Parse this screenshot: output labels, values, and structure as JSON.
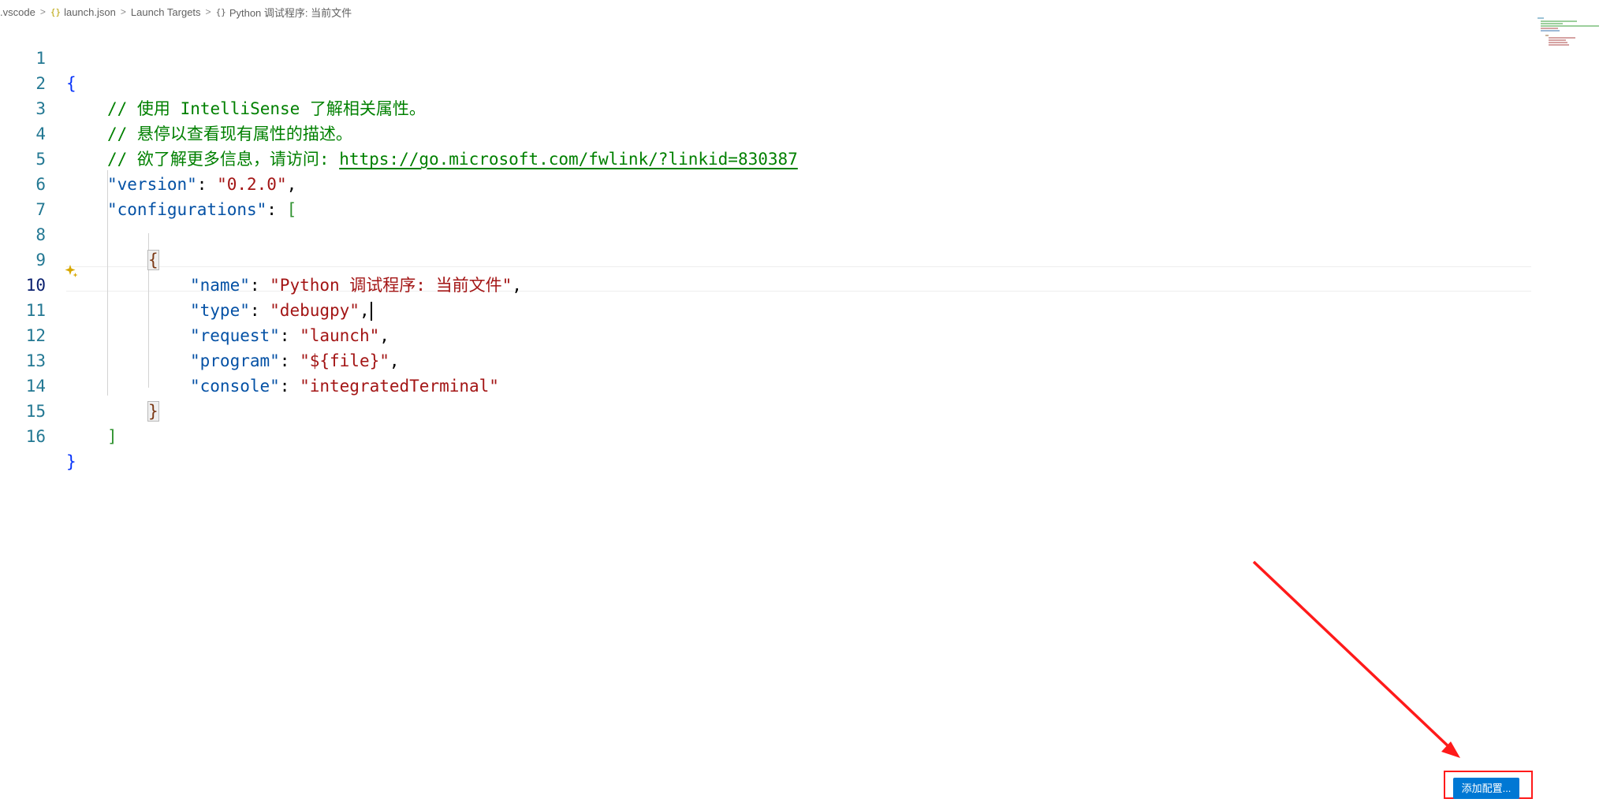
{
  "breadcrumb": {
    "folder": ".vscode",
    "file_icon": "{}",
    "file": "launch.json",
    "section": "Launch Targets",
    "object_icon": "{}",
    "item": "Python 调试程序: 当前文件",
    "separator": ">"
  },
  "editor": {
    "active_line": 10,
    "lines": [
      {
        "num": "1"
      },
      {
        "num": "2",
        "comment": "// 使用 IntelliSense 了解相关属性。"
      },
      {
        "num": "3",
        "comment": "// 悬停以查看现有属性的描述。"
      },
      {
        "num": "4",
        "comment": "// 欲了解更多信息，请访问: ",
        "link": "https://go.microsoft.com/fwlink/?linkid=830387"
      },
      {
        "num": "5",
        "key": "\"version\"",
        "value": "\"0.2.0\""
      },
      {
        "num": "6",
        "key": "\"configurations\""
      },
      {
        "num": "7"
      },
      {
        "num": "8"
      },
      {
        "num": "9",
        "key": "\"name\"",
        "value": "\"Python 调试程序: 当前文件\""
      },
      {
        "num": "10",
        "key": "\"type\"",
        "value": "\"debugpy\""
      },
      {
        "num": "11",
        "key": "\"request\"",
        "value": "\"launch\""
      },
      {
        "num": "12",
        "key": "\"program\"",
        "value": "\"${file}\""
      },
      {
        "num": "13",
        "key": "\"console\"",
        "value": "\"integratedTerminal\""
      },
      {
        "num": "14"
      },
      {
        "num": "15"
      },
      {
        "num": "16"
      }
    ],
    "punct": {
      "open_brace": "{",
      "close_brace": "}",
      "open_bracket": "[",
      "close_bracket": "]",
      "colon": ": ",
      "comma": ","
    }
  },
  "actions": {
    "add_configuration_label": "添加配置..."
  },
  "colors": {
    "line_number": "#237893",
    "comment": "#008000",
    "key": "#0451a5",
    "string": "#a31515",
    "button": "#0078d4",
    "annotation": "#ff1a1a"
  },
  "icons": [
    "chevron-right-icon",
    "json-braces-icon",
    "object-braces-icon",
    "sparkle-icon",
    "arrow-annotation"
  ]
}
